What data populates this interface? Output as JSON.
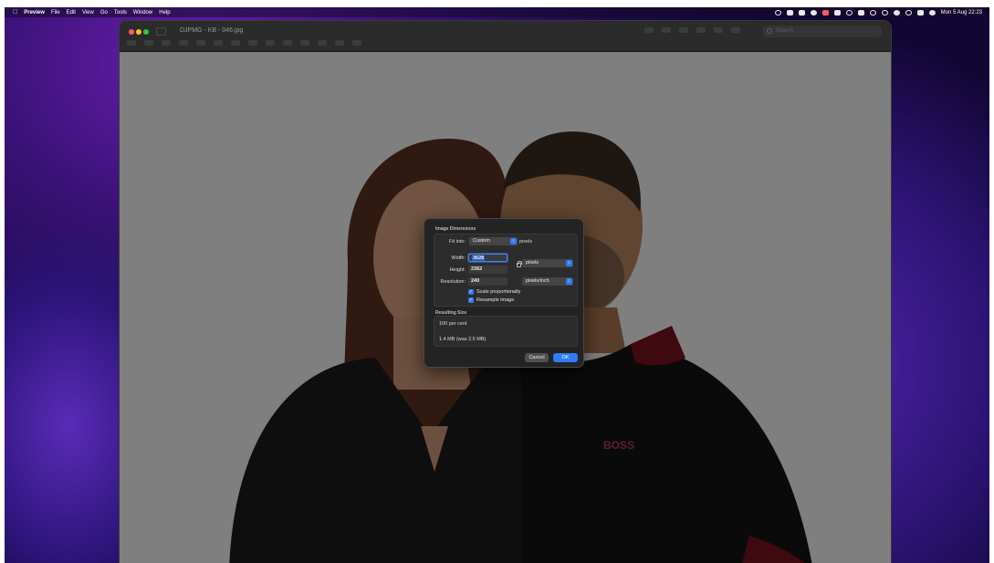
{
  "menubar": {
    "apple": "",
    "app": "Preview",
    "items": [
      "File",
      "Edit",
      "View",
      "Go",
      "Tools",
      "Window",
      "Help"
    ],
    "clock": "Mon 5 Aug  22:23"
  },
  "window": {
    "title": "DJPMG - KB - 046.jpg",
    "search_placeholder": "Search"
  },
  "dialog": {
    "dimensions_title": "Image Dimensions",
    "fit_into_label": "Fit into:",
    "fit_into_value": "Custom",
    "fit_into_unit": "pixels",
    "width_label": "Width:",
    "width_value": "3628",
    "height_label": "Height:",
    "height_value": "2362",
    "resolution_label": "Resolution:",
    "resolution_value": "240",
    "size_unit": "pixels",
    "resolution_unit": "pixels/inch",
    "scale_label": "Scale proportionally",
    "scale_checked": true,
    "resample_label": "Resample image",
    "resample_checked": true,
    "resulting_title": "Resulting Size",
    "percent": "100 per cent",
    "filesize": "1.4 MB (was 2.5 MB)",
    "cancel": "Cancel",
    "ok": "OK"
  },
  "photo": {
    "shirt_logo": "BOSS"
  }
}
